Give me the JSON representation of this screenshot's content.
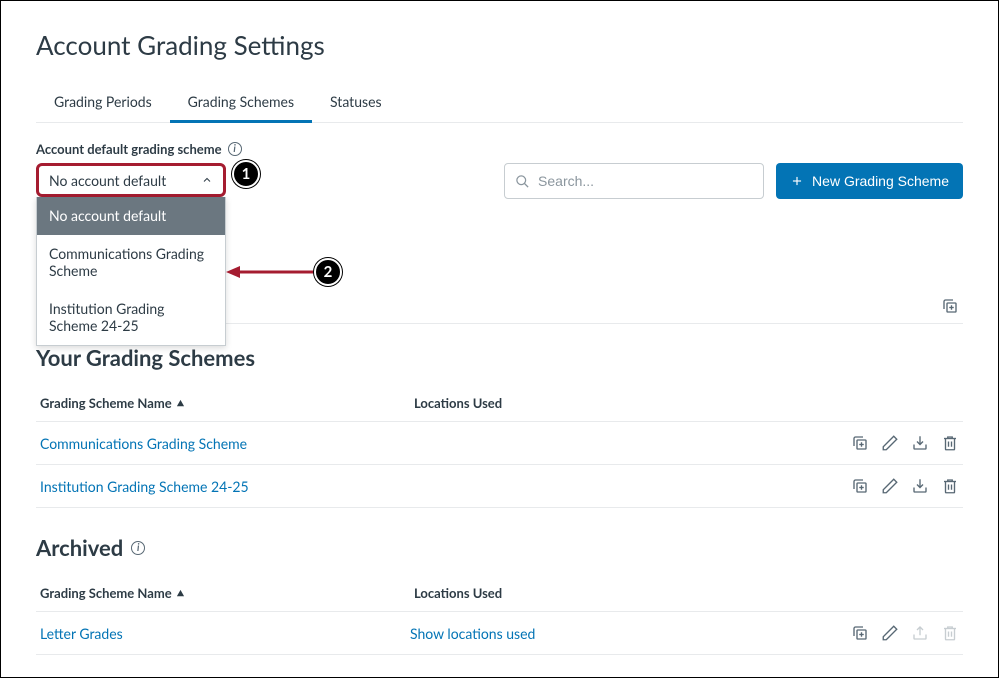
{
  "page_title": "Account Grading Settings",
  "tabs": {
    "periods": "Grading Periods",
    "schemes": "Grading Schemes",
    "statuses": "Statuses"
  },
  "default_label": "Account default grading scheme",
  "dropdown": {
    "selected": "No account default",
    "options": {
      "none": "No account default",
      "comm": "Communications Grading Scheme",
      "inst": "Institution Grading Scheme 24-25"
    }
  },
  "search": {
    "placeholder": "Search..."
  },
  "new_btn": "New Grading Scheme",
  "your_schemes_title": "Your Grading Schemes",
  "headers": {
    "name": "Grading Scheme Name",
    "locations": "Locations Used"
  },
  "schemes": {
    "comm": "Communications Grading Scheme",
    "inst": "Institution Grading Scheme 24-25"
  },
  "archived_title": "Archived",
  "archived": {
    "letter": "Letter Grades",
    "show_loc": "Show locations used"
  },
  "callouts": {
    "one": "1",
    "two": "2"
  }
}
